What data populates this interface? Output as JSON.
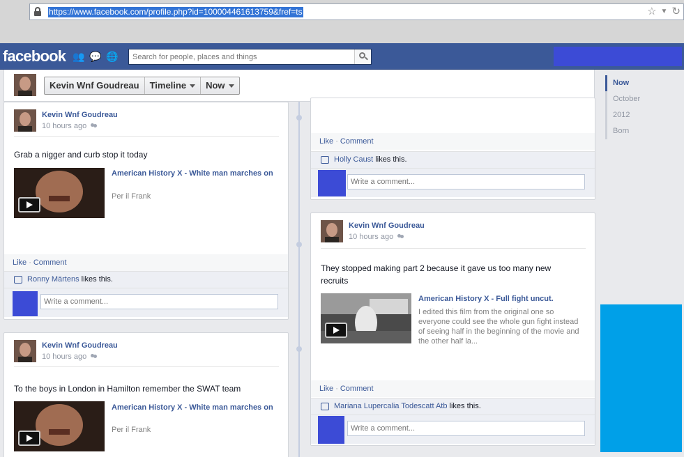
{
  "browser": {
    "url": "https://www.facebook.com/profile.php?id=100004461613759&fref=ts"
  },
  "fb": {
    "logo": "facebook",
    "search_placeholder": "Search for people, places and things"
  },
  "timeline": {
    "name": "Kevin Wnf Goudreau",
    "section": "Timeline",
    "period": "Now"
  },
  "scrubber": [
    "Now",
    "October",
    "2012",
    "Born"
  ],
  "posts": [
    {
      "author": "Kevin Wnf Goudreau",
      "time": "10 hours ago",
      "text": "Grab a nigger and curb stop it today",
      "share_title": "American History X - White man marches on",
      "share_sub": "Per il Frank",
      "like": "Like",
      "comment": "Comment",
      "liker": "Ronny Märtens",
      "likes_suffix": " likes this.",
      "comment_placeholder": "Write a comment..."
    },
    {
      "author": "Kevin Wnf Goudreau",
      "time": "10 hours ago",
      "text": "To the boys in London in Hamilton remember the SWAT team",
      "share_title": "American History X - White man marches on",
      "share_sub": "Per il Frank"
    },
    {
      "like": "Like",
      "comment": "Comment",
      "liker": "Holly Caust",
      "likes_suffix": " likes this.",
      "comment_placeholder": "Write a comment..."
    },
    {
      "author": "Kevin Wnf Goudreau",
      "time": "10 hours ago",
      "text": "They stopped making part 2 because it gave us too many new recruits",
      "share_title": "American History X - Full fight uncut.",
      "share_sub": "I edited this film from the original one so everyone could see the whole gun fight instead of seeing half in the beginning of the movie and the other half la...",
      "like": "Like",
      "comment": "Comment",
      "liker": "Mariana Lupercalia Todescatt Atb",
      "likes_suffix": " likes this.",
      "comment_placeholder": "Write a comment..."
    }
  ]
}
